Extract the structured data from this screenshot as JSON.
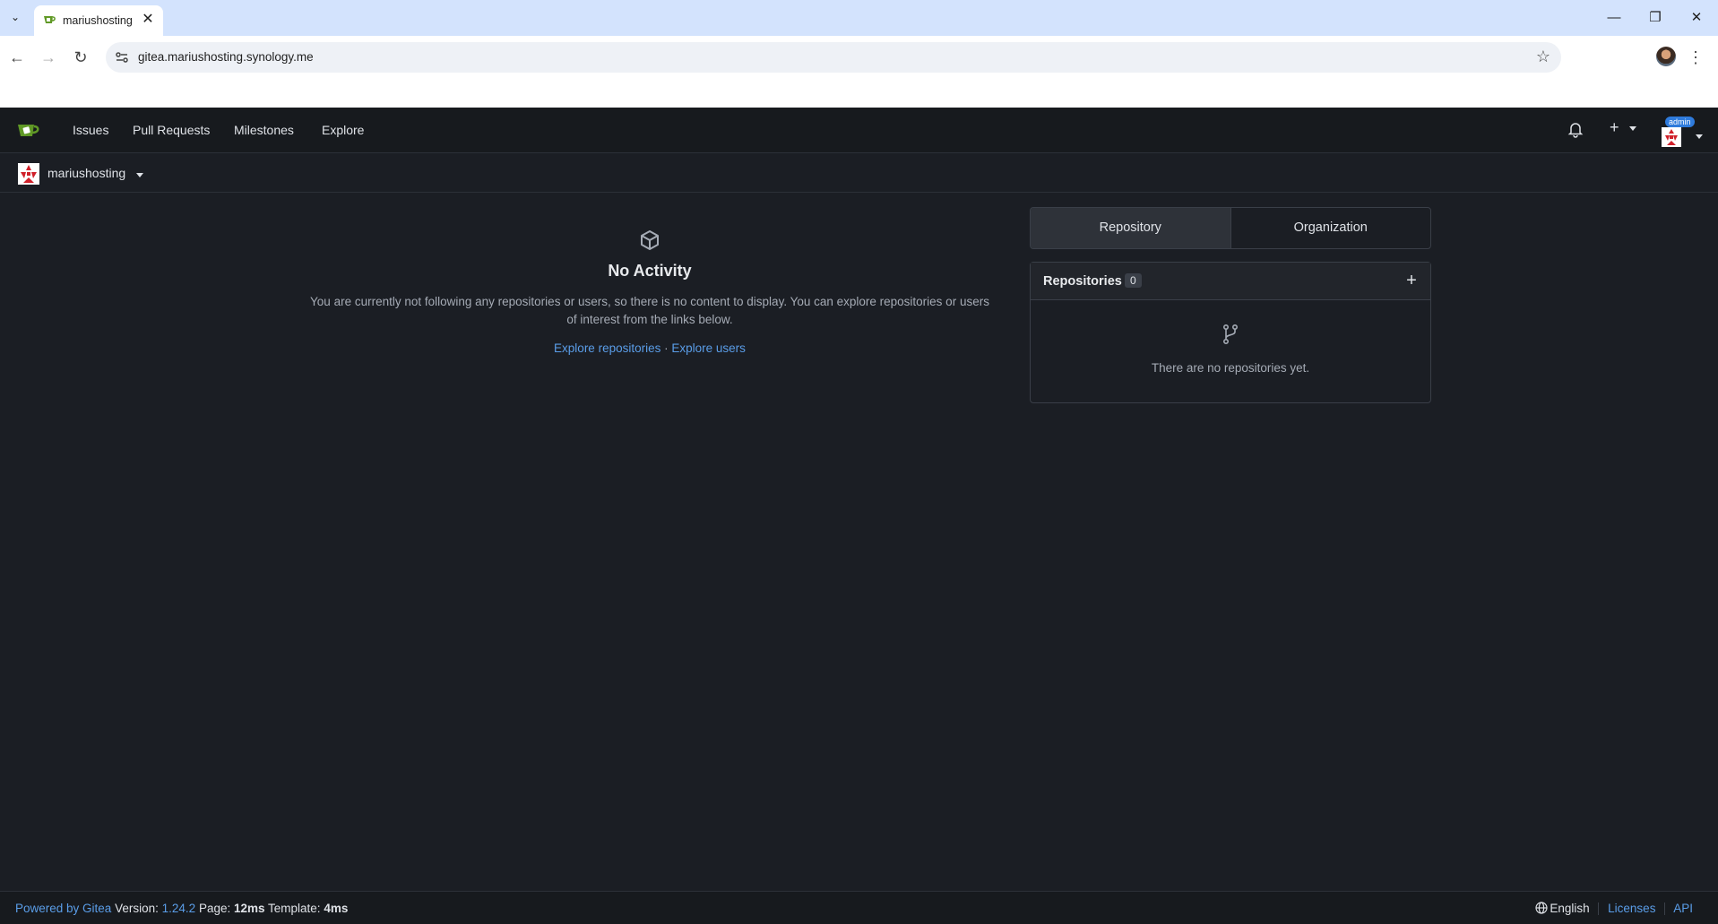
{
  "browser": {
    "tab_title": "mariushosting",
    "url": "gitea.mariushosting.synology.me",
    "window_controls": [
      "minimize-icon",
      "restore-icon",
      "close-icon"
    ]
  },
  "navbar": {
    "items": [
      "Issues",
      "Pull Requests",
      "Milestones",
      "Explore"
    ],
    "admin_badge": "admin"
  },
  "context": {
    "username": "mariushosting"
  },
  "activity": {
    "title": "No Activity",
    "description": "You are currently not following any repositories or users, so there is no content to display. You can explore repositories or users of interest from the links below.",
    "explore_repos": "Explore repositories",
    "separator": "·",
    "explore_users": "Explore users"
  },
  "panel": {
    "tabs": [
      "Repository",
      "Organization"
    ],
    "active_tab": "Repository",
    "repos_title": "Repositories",
    "repos_count": "0",
    "empty_text": "There are no repositories yet."
  },
  "footer": {
    "powered": "Powered by Gitea",
    "version_label": "Version:",
    "version": "1.24.2",
    "page_label": "Page:",
    "page_time": "12ms",
    "template_label": "Template:",
    "template_time": "4ms",
    "language": "English",
    "licenses": "Licenses",
    "api": "API"
  },
  "colors": {
    "background": "#1b1e24",
    "navbar": "#171a1e",
    "link": "#5a9de8",
    "tabstrip": "#d3e3fd",
    "gitea_green": "#609926"
  }
}
